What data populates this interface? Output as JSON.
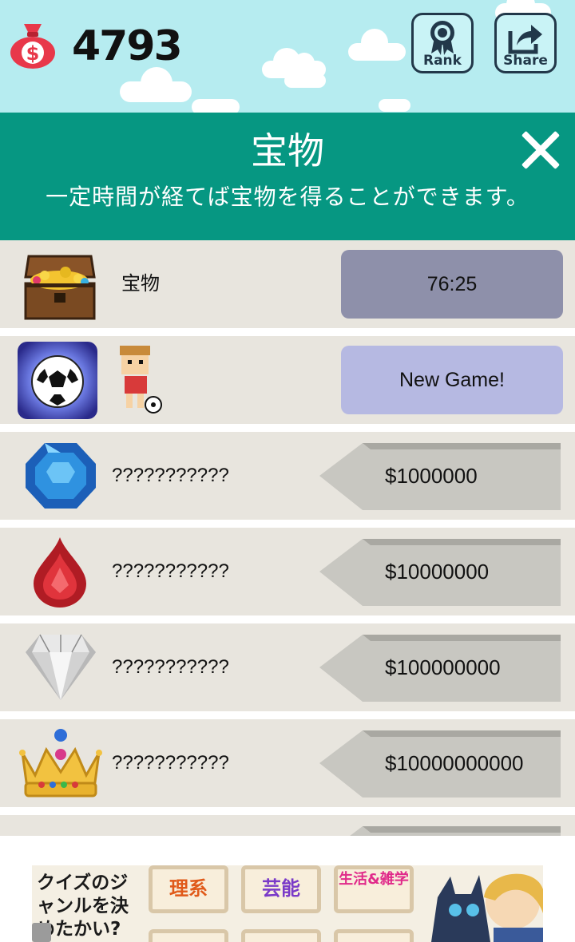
{
  "header": {
    "coins": "4793",
    "rank_label": "Rank",
    "share_label": "Share"
  },
  "panel": {
    "title": "宝物",
    "subtitle": "一定時間が経てば宝物を得ることができます。"
  },
  "rows": [
    {
      "label": "宝物",
      "action": "76:25",
      "icon": "treasure-chest-icon"
    },
    {
      "action": "New Game!",
      "icon": "soccer-game-icon"
    },
    {
      "label": "???????????",
      "price": "$1000000",
      "icon": "blue-gem-icon"
    },
    {
      "label": "???????????",
      "price": "$10000000",
      "icon": "red-gem-icon"
    },
    {
      "label": "???????????",
      "price": "$100000000",
      "icon": "diamond-icon"
    },
    {
      "label": "???????????",
      "price": "$10000000000",
      "icon": "crown-icon"
    }
  ],
  "ad": {
    "copy": "クイズのジャンルを決めたかい?",
    "tiles": [
      "理系",
      "芸能",
      "生活&雑学"
    ]
  },
  "colors": {
    "sky": "#b6ecf0",
    "panel": "#069782",
    "row": "#e8e5de",
    "timer_button": "#8e90aa",
    "new_game_button": "#b6b9e2",
    "price_tag": "#c8c7c1"
  }
}
